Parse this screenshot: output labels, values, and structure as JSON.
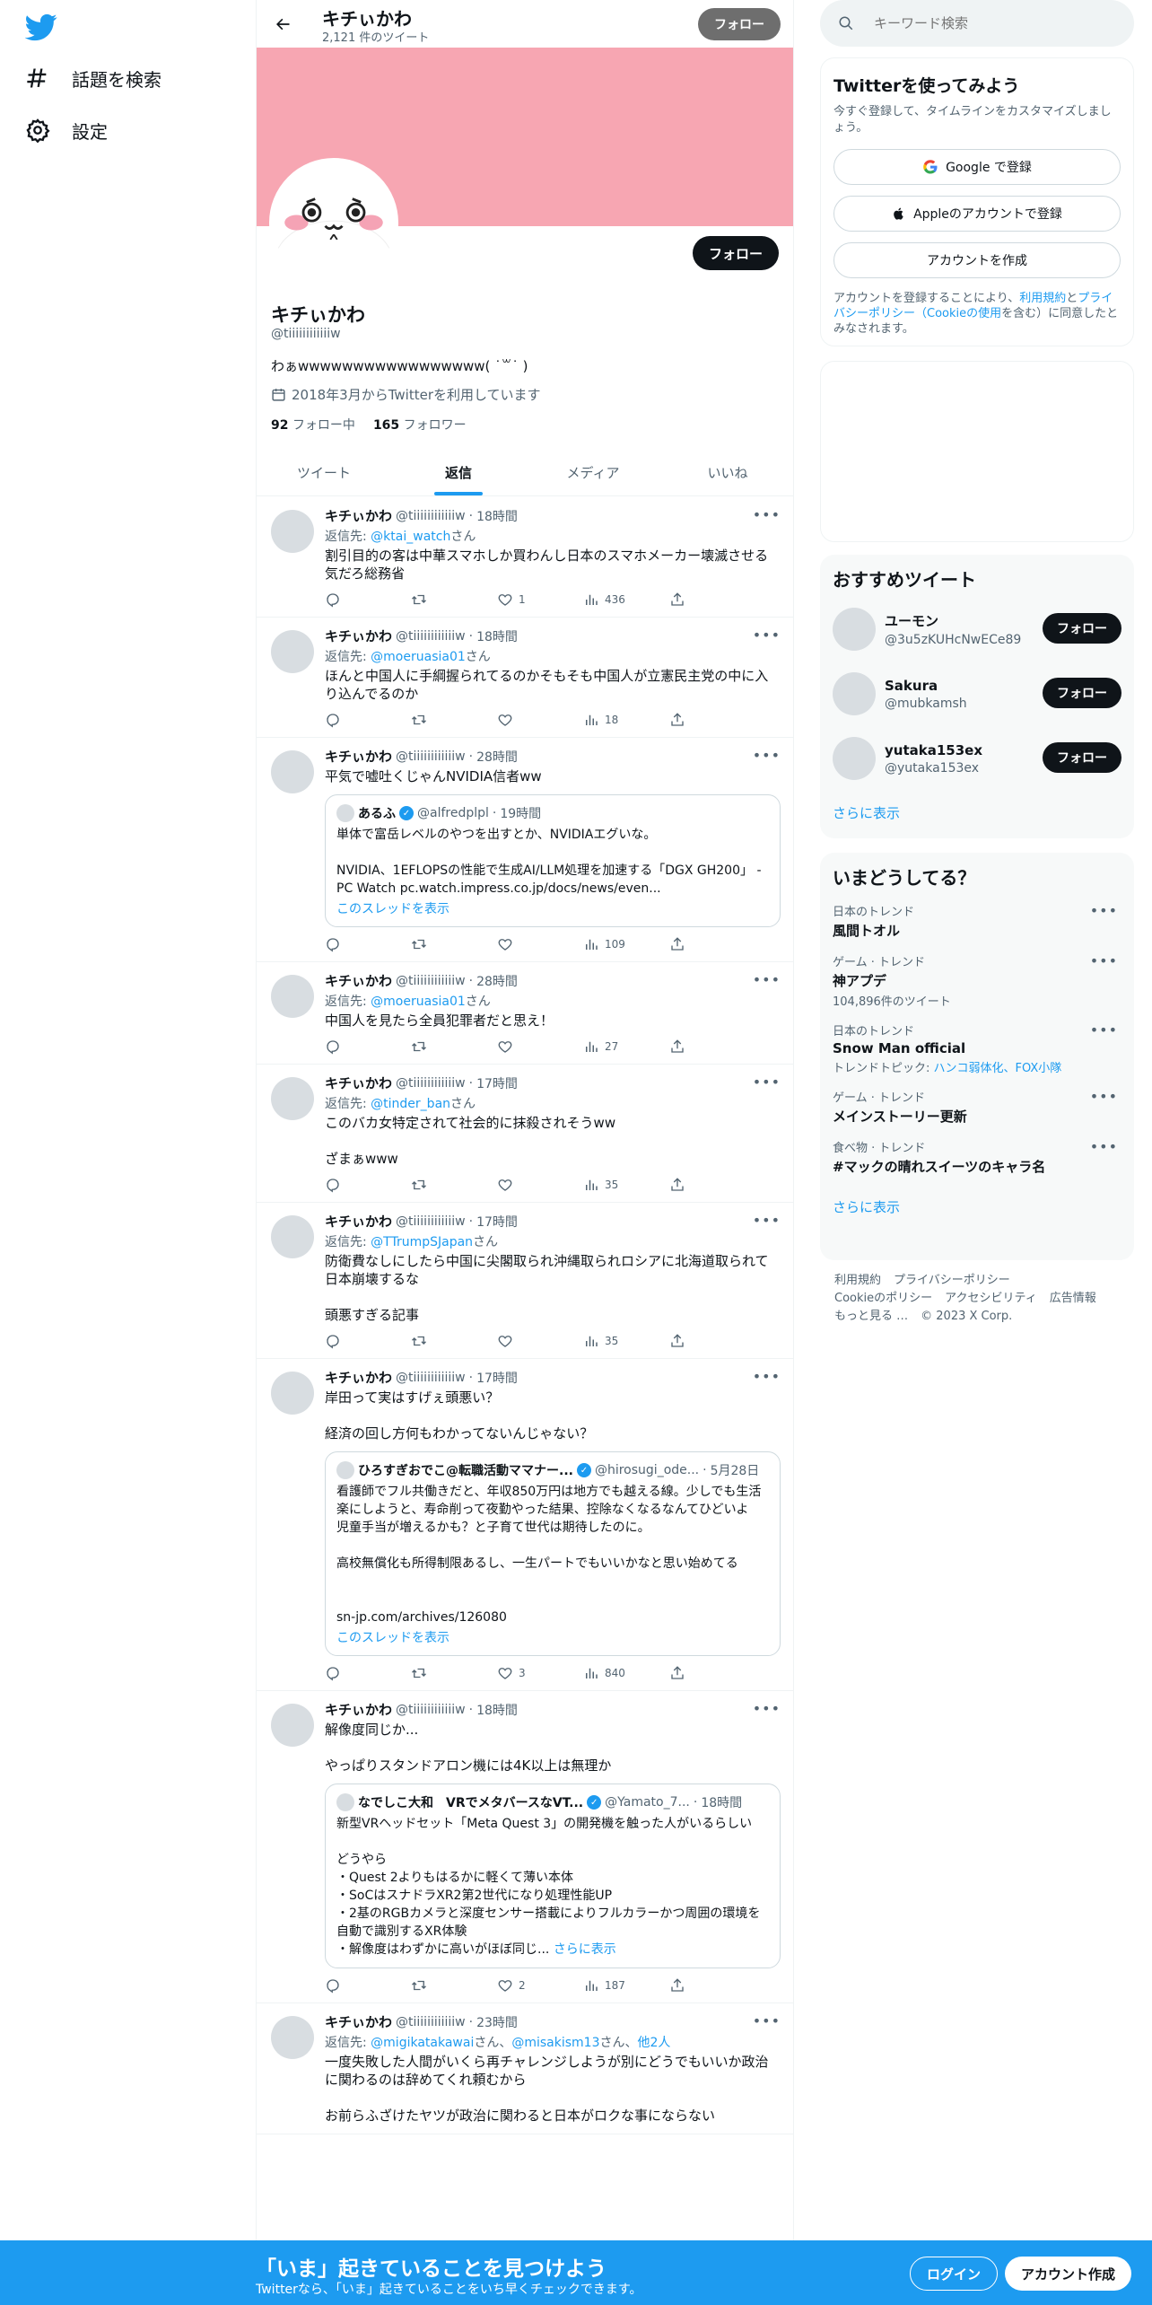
{
  "nav": {
    "explore": "話題を検索",
    "settings": "設定"
  },
  "header": {
    "name": "キチぃかわ",
    "tweet_count": "2,121 件のツイート",
    "follow_label": "フォロー"
  },
  "profile": {
    "name": "キチぃかわ",
    "handle": "@tiiiiiiiiiiiiw",
    "bio": "わぁwwwwwwwwwwwwwwwww( ˙꒳˙ )",
    "joined": "2018年3月からTwitterを利用しています",
    "following_count": "92",
    "following_label": "フォロー中",
    "followers_count": "165",
    "followers_label": "フォロワー",
    "follow_label": "フォロー",
    "banner_color": "#f7a6b2"
  },
  "tabs": [
    "ツイート",
    "返信",
    "メディア",
    "いいね"
  ],
  "tweets": [
    {
      "name": "キチぃかわ",
      "handle": "@tiiiiiiiiiiiiw",
      "time": "18時間",
      "reply_prefix": "返信先: ",
      "reply_to": "@ktai_watch",
      "reply_suffix": "さん",
      "text": "割引目的の客は中華スマホしか買わんし日本のスマホメーカー壊滅させる気だろ総務省",
      "likes": "1",
      "views": "436"
    },
    {
      "name": "キチぃかわ",
      "handle": "@tiiiiiiiiiiiiw",
      "time": "18時間",
      "reply_prefix": "返信先: ",
      "reply_to": "@moeruasia01",
      "reply_suffix": "さん",
      "text": "ほんと中国人に手綱握られてるのかそもそも中国人が立憲民主党の中に入り込んでるのか",
      "likes": "",
      "views": "18"
    },
    {
      "name": "キチぃかわ",
      "handle": "@tiiiiiiiiiiiiw",
      "time": "28時間",
      "text": "平気で嘘吐くじゃんNVIDIA信者ww",
      "likes": "",
      "views": "109",
      "quote": {
        "name": "あるふ",
        "handle": "@alfredplpl",
        "time": "19時間",
        "text": "単体で富岳レベルのやつを出すとか、NVIDIAエグいな。\n\nNVIDIA、1EFLOPSの性能で生成AI/LLM処理を加速する「DGX GH200」 - PC Watch pc.watch.impress.co.jp/docs/news/even...",
        "thread": "このスレッドを表示"
      }
    },
    {
      "name": "キチぃかわ",
      "handle": "@tiiiiiiiiiiiiw",
      "time": "28時間",
      "reply_prefix": "返信先: ",
      "reply_to": "@moeruasia01",
      "reply_suffix": "さん",
      "text": "中国人を見たら全員犯罪者だと思え！",
      "likes": "",
      "views": "27"
    },
    {
      "name": "キチぃかわ",
      "handle": "@tiiiiiiiiiiiiw",
      "time": "17時間",
      "reply_prefix": "返信先: ",
      "reply_to": "@tinder_ban",
      "reply_suffix": "さん",
      "text": "このバカ女特定されて社会的に抹殺されそうww\n\nざまぁwww",
      "likes": "",
      "views": "35"
    },
    {
      "name": "キチぃかわ",
      "handle": "@tiiiiiiiiiiiiw",
      "time": "17時間",
      "reply_prefix": "返信先: ",
      "reply_to": "@TTrumpSJapan",
      "reply_suffix": "さん",
      "text": "防衛費なしにしたら中国に尖閣取られ沖縄取られロシアに北海道取られて日本崩壊するな\n\n頭悪すぎる記事",
      "likes": "",
      "views": "35"
    },
    {
      "name": "キチぃかわ",
      "handle": "@tiiiiiiiiiiiiw",
      "time": "17時間",
      "text": "岸田って実はすげぇ頭悪い？\n\n経済の回し方何もわかってないんじゃない？",
      "likes": "3",
      "views": "840",
      "quote": {
        "name": "ひろすぎおでこ@転職活動ママナー...",
        "handle": "@hirosugi_ode...",
        "time": "5月28日",
        "text": "看護師でフル共働きだと、年収850万円は地方でも越える線。少しでも生活楽にしようと、寿命削って夜勤やった結果、控除なくなるなんてひどいよ\n児童手当が増えるかも？と子育て世代は期待したのに。\n\n高校無償化も所得制限あるし、一生パートでもいいかなと思い始めてる\n\n\nsn-jp.com/archives/126080",
        "thread": "このスレッドを表示"
      }
    },
    {
      "name": "キチぃかわ",
      "handle": "@tiiiiiiiiiiiiw",
      "time": "18時間",
      "text": "解像度同じか...\n\nやっぱりスタンドアロン機には4K以上は無理か",
      "likes": "2",
      "views": "187",
      "quote": {
        "name": "なでしこ大和　VRでメタバースなVT...",
        "handle": "@Yamato_7...",
        "time": "18時間",
        "text": "新型VRヘッドセット「Meta Quest 3」の開発機を触った人がいるらしい\n\nどうやら\n・Quest 2よりもはるかに軽くて薄い本体\n・SoCはスナドラXR2第2世代になり処理性能UP\n・2基のRGBカメラと深度センサー搭載によりフルカラーかつ周囲の環境を自動で識別するXR体験\n・解像度はわずかに高いがほぼ同じ...",
        "more": "さらに表示"
      }
    },
    {
      "name": "キチぃかわ",
      "handle": "@tiiiiiiiiiiiiw",
      "time": "23時間",
      "reply_prefix": "返信先: ",
      "reply_to": "@migikatakawai",
      "reply_mid": "さん、",
      "reply_to2": "@misakism13",
      "reply_suffix2": "さん、",
      "reply_others": "他2人",
      "text": "一度失敗した人間がいくら再チャレンジしようが別にどうでもいいか政治に関わるのは辞めてくれ頼むから\n\nお前らふざけたヤツが政治に関わると日本がロクな事にならない",
      "likes": "",
      "views": ""
    }
  ],
  "search": {
    "placeholder": "キーワード検索"
  },
  "signup": {
    "title": "Twitterを使ってみよう",
    "subtitle": "今すぐ登録して、タイムラインをカスタマイズしましょう。",
    "google": "Google で登録",
    "apple": "Appleのアカウントで登録",
    "create": "アカウントを作成",
    "legal_1": "アカウントを登録することにより、",
    "legal_terms": "利用規約",
    "legal_2": "と",
    "legal_privacy": "プライバシーポリシー（Cookieの使用",
    "legal_3": "を含む）に同意したとみなされます。"
  },
  "recommend": {
    "title": "おすすめツイート",
    "users": [
      {
        "name": "ユーモン",
        "handle": "@3u5zKUHcNwECe89"
      },
      {
        "name": "Sakura",
        "handle": "@mubkamsh"
      },
      {
        "name": "yutaka153ex",
        "handle": "@yutaka153ex"
      }
    ],
    "follow_label": "フォロー",
    "more": "さらに表示"
  },
  "trends": {
    "title": "いまどうしてる？",
    "items": [
      {
        "context": "日本のトレンド",
        "name": "風間トオル",
        "sub": ""
      },
      {
        "context": "ゲーム · トレンド",
        "name": "神アプデ",
        "sub": "104,896件のツイート"
      },
      {
        "context": "日本のトレンド",
        "name": "Snow Man official",
        "sub_prefix": "トレンドトピック: ",
        "sub_links": "ハンコ弱体化、FOX小隊"
      },
      {
        "context": "ゲーム · トレンド",
        "name": "メインストーリー更新",
        "sub": ""
      },
      {
        "context": "食べ物 · トレンド",
        "name": "#マックの晴れスイーツのキャラ名",
        "sub": ""
      }
    ],
    "more": "さらに表示"
  },
  "footer": [
    "利用規約",
    "プライバシーポリシー",
    "Cookieのポリシー",
    "アクセシビリティ",
    "広告情報",
    "もっと見る …",
    "© 2023 X Corp."
  ],
  "bottom": {
    "title": "「いま」起きていることを見つけよう",
    "subtitle": "Twitterなら、「いま」起きていることをいち早くチェックできます。",
    "login": "ログイン",
    "signup": "アカウント作成"
  }
}
